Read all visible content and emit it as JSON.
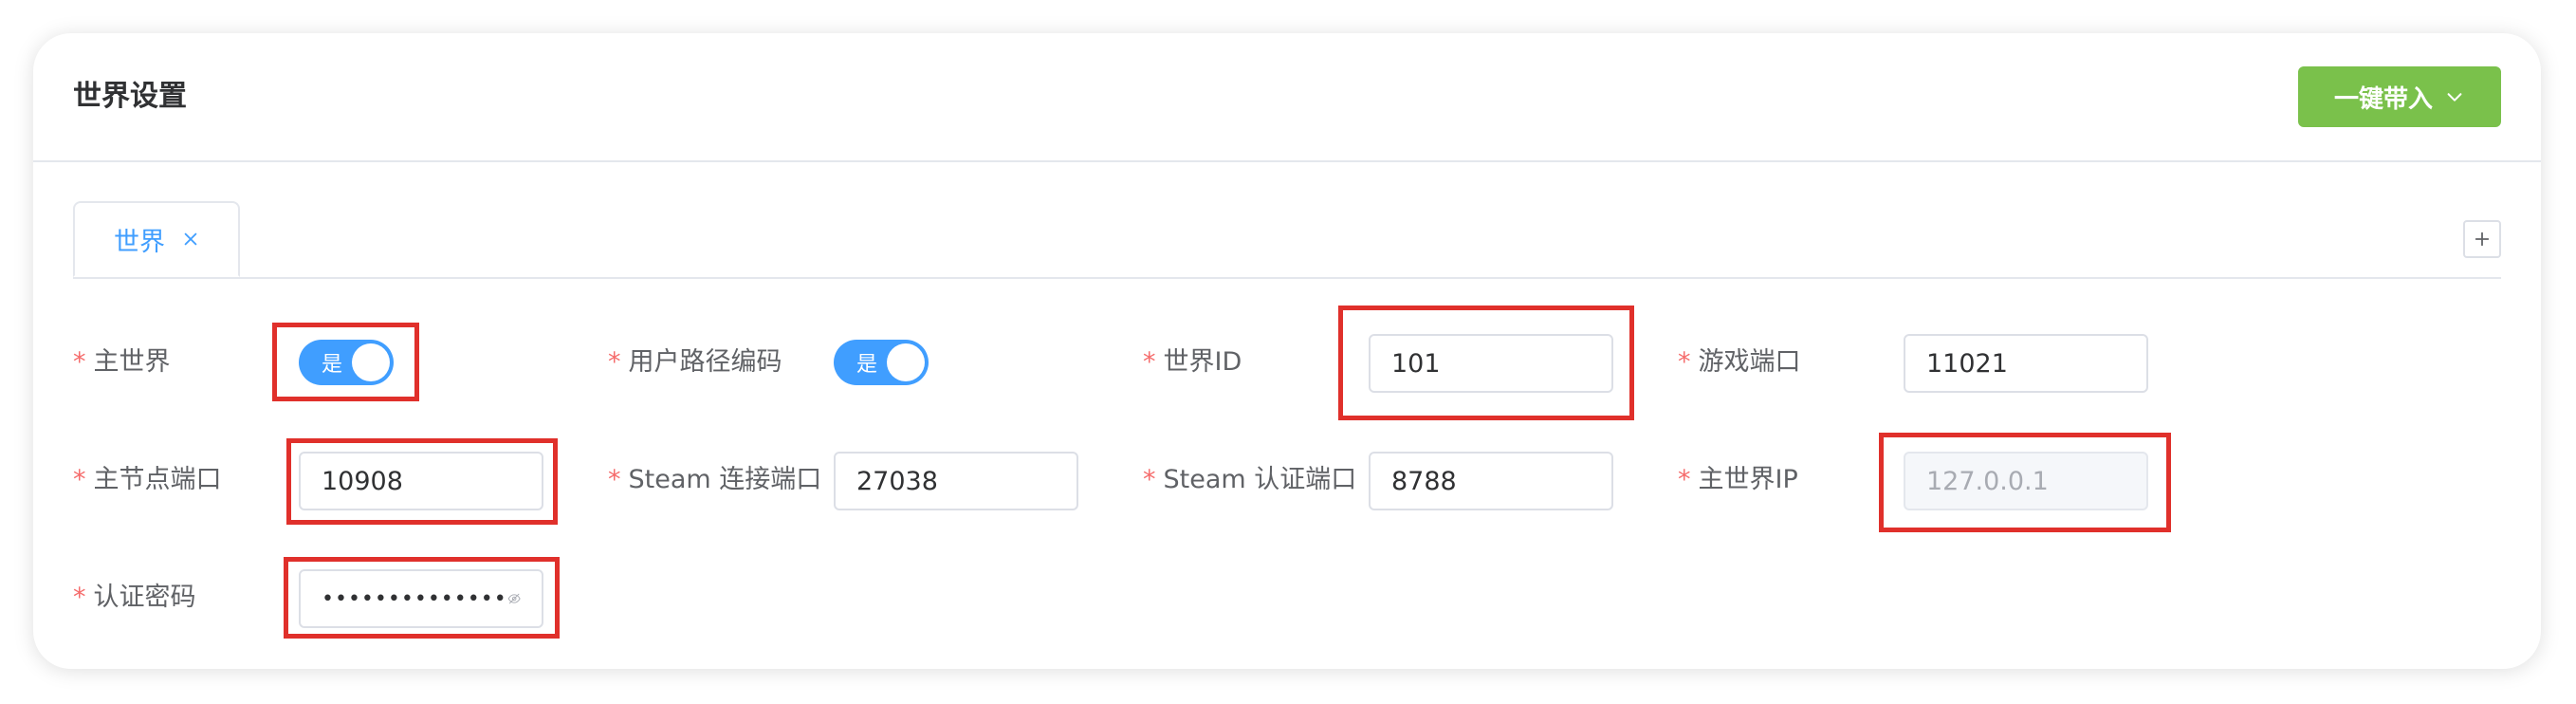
{
  "card": {
    "title": "世界设置",
    "action_button_label": "一键带入"
  },
  "tabs": [
    {
      "label": "世界",
      "active": true
    }
  ],
  "fields": {
    "main_world": {
      "label": "主世界",
      "switch_text": "是",
      "value": true
    },
    "user_path_encoding": {
      "label": "用户路径编码",
      "switch_text": "是",
      "value": true
    },
    "world_id": {
      "label": "世界ID",
      "value": "101"
    },
    "game_port": {
      "label": "游戏端口",
      "value": "11021"
    },
    "master_node_port": {
      "label": "主节点端口",
      "value": "10908"
    },
    "steam_conn_port": {
      "label": "Steam 连接端口",
      "value": "27038"
    },
    "steam_auth_port": {
      "label": "Steam 认证端口",
      "value": "8788"
    },
    "main_world_ip": {
      "label": "主世界IP",
      "placeholder": "127.0.0.1"
    },
    "auth_password": {
      "label": "认证密码",
      "value": "••••••••••••••"
    }
  },
  "icons": {
    "dropdown": "chevron-down-icon",
    "tab_close": "close-icon",
    "add_tab": "plus-icon",
    "password_toggle": "eye-off-icon"
  },
  "colors": {
    "primary_button": "#7ac14b",
    "switch_on": "#409eff",
    "active_tab_text": "#409eff",
    "required_mark": "#f56c6c",
    "highlight_box": "#e0302b"
  }
}
